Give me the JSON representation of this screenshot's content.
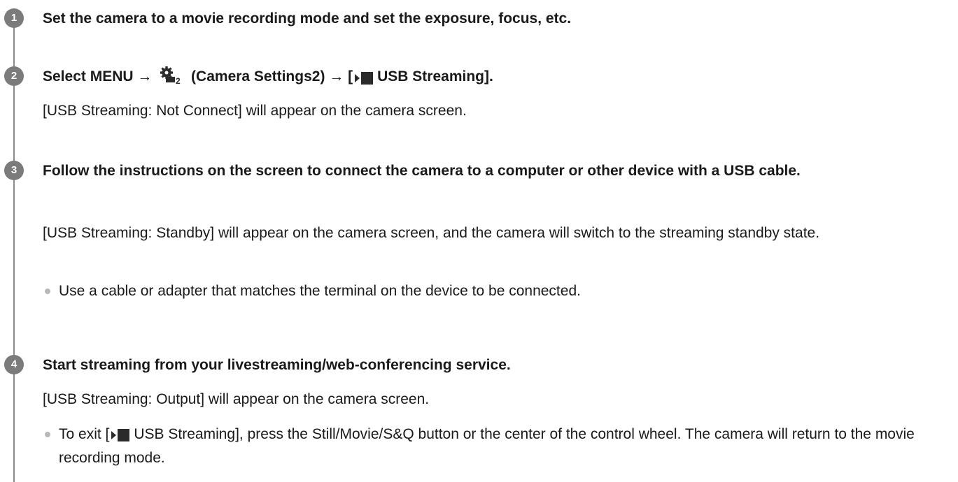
{
  "steps": [
    {
      "number": "1",
      "title": "Set the camera to a movie recording mode and set the exposure, focus, etc."
    },
    {
      "number": "2",
      "title_prefix": "Select MENU → ",
      "title_icon_cam": "camera-settings-2-icon",
      "title_middle": " (Camera Settings2) → [",
      "title_icon_movie": "movie-icon",
      "title_suffix": "USB Streaming].",
      "desc": "[USB Streaming: Not Connect] will appear on the camera screen."
    },
    {
      "number": "3",
      "title": "Follow the instructions on the screen to connect the camera to a computer or other device with a USB cable.",
      "desc": "[USB Streaming: Standby] will appear on the camera screen, and the camera will switch to the streaming standby state.",
      "bullet": "Use a cable or adapter that matches the terminal on the device to be connected."
    },
    {
      "number": "4",
      "title": "Start streaming from your livestreaming/web-conferencing service.",
      "desc": "[USB Streaming: Output] will appear on the camera screen.",
      "bullet_prefix": "To exit [",
      "bullet_icon": "movie-icon",
      "bullet_suffix": "USB Streaming], press the Still/Movie/S&Q button or the center of the control wheel. The camera will return to the movie recording mode."
    }
  ],
  "colors": {
    "badge": "#7b7b7b",
    "rail": "#8a8a8a",
    "bullet_dot": "#b9b9b9",
    "text": "#1a1a1a"
  }
}
